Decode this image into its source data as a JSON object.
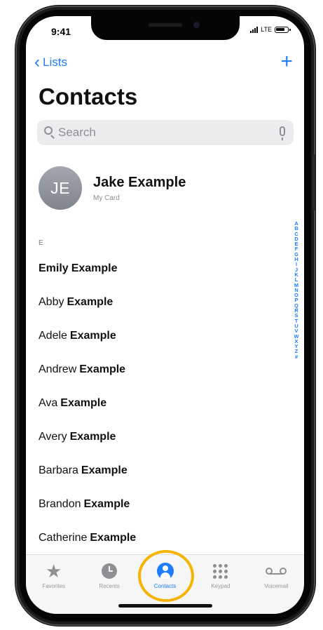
{
  "status_bar": {
    "time": "9:41",
    "carrier": "LTE"
  },
  "nav": {
    "back_label": "Lists",
    "add_label": "+"
  },
  "page_title": "Contacts",
  "search": {
    "placeholder": "Search"
  },
  "my_card": {
    "initials": "JE",
    "name": "Jake Example",
    "subtitle": "My Card"
  },
  "section_letter": "E",
  "contacts": [
    {
      "first": "Emily",
      "last": "Example",
      "all_bold": true
    },
    {
      "first": "Abby",
      "last": "Example"
    },
    {
      "first": "Adele",
      "last": "Example"
    },
    {
      "first": "Andrew",
      "last": "Example"
    },
    {
      "first": "Ava",
      "last": "Example"
    },
    {
      "first": "Avery",
      "last": "Example"
    },
    {
      "first": "Barbara",
      "last": "Example"
    },
    {
      "first": "Brandon",
      "last": "Example"
    },
    {
      "first": "Catherine",
      "last": "Example"
    }
  ],
  "index_letters": [
    "A",
    "B",
    "C",
    "D",
    "E",
    "F",
    "G",
    "H",
    "I",
    "J",
    "K",
    "L",
    "M",
    "N",
    "O",
    "P",
    "Q",
    "R",
    "S",
    "T",
    "U",
    "V",
    "W",
    "X",
    "Y",
    "Z",
    "#"
  ],
  "tabs": [
    {
      "label": "Favorites",
      "icon": "star-icon"
    },
    {
      "label": "Recents",
      "icon": "clock-icon"
    },
    {
      "label": "Contacts",
      "icon": "person-circle-icon",
      "active": true
    },
    {
      "label": "Keypad",
      "icon": "keypad-icon"
    },
    {
      "label": "Voicemail",
      "icon": "voicemail-icon"
    }
  ],
  "colors": {
    "accent": "#1f7cff",
    "highlight": "#f6b300"
  }
}
